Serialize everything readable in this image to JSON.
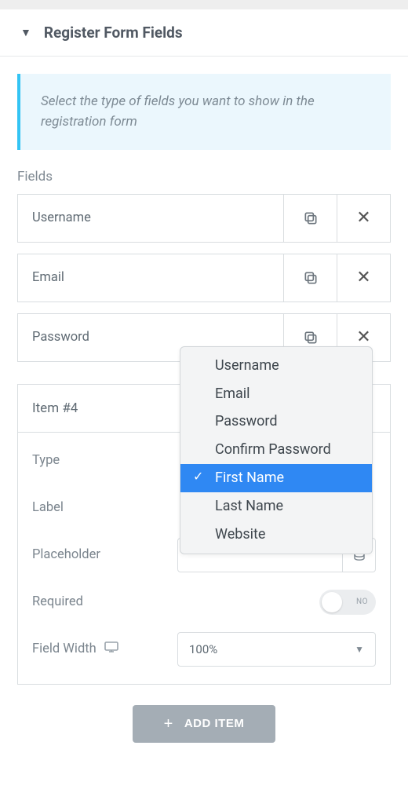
{
  "header": {
    "title": "Register Form Fields"
  },
  "info": {
    "text": "Select the type of fields you want to show in the registration form"
  },
  "fields_section": {
    "label": "Fields",
    "items": [
      {
        "label": "Username"
      },
      {
        "label": "Email"
      },
      {
        "label": "Password"
      }
    ]
  },
  "editor": {
    "title": "Item #4",
    "rows": {
      "type": {
        "label": "Type"
      },
      "label": {
        "label": "Label"
      },
      "placeholder": {
        "label": "Placeholder"
      },
      "required": {
        "label": "Required",
        "toggle_text": "NO"
      },
      "field_width": {
        "label": "Field Width",
        "value": "100%"
      }
    }
  },
  "dropdown": {
    "options": [
      {
        "label": "Username",
        "selected": false
      },
      {
        "label": "Email",
        "selected": false
      },
      {
        "label": "Password",
        "selected": false
      },
      {
        "label": "Confirm Password",
        "selected": false
      },
      {
        "label": "First Name",
        "selected": true
      },
      {
        "label": "Last Name",
        "selected": false
      },
      {
        "label": "Website",
        "selected": false
      }
    ]
  },
  "add_button": {
    "label": "ADD ITEM"
  }
}
